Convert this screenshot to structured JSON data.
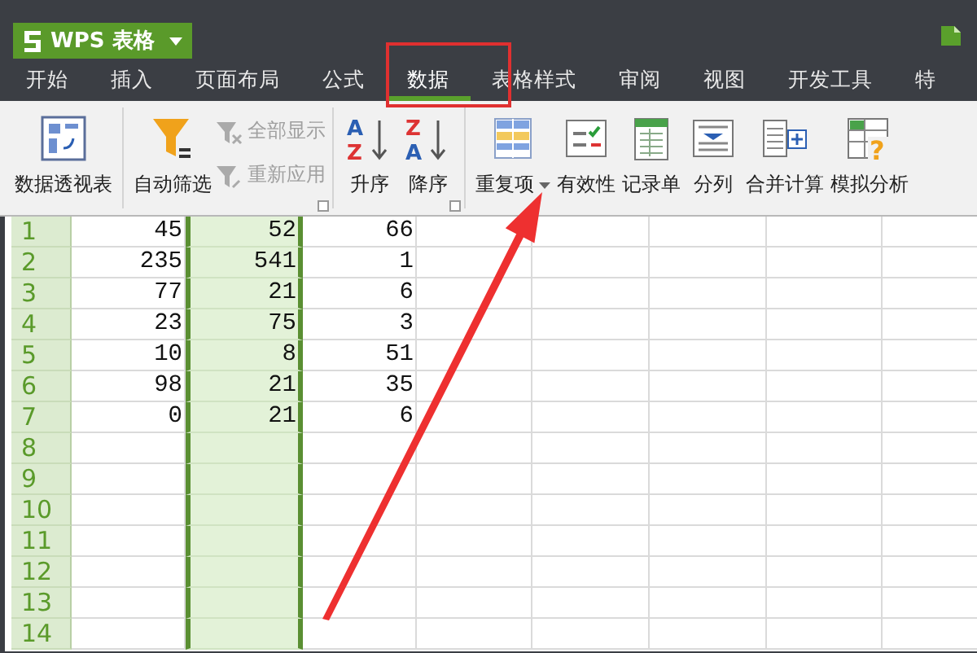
{
  "app": {
    "title": "WPS 表格"
  },
  "tabs": [
    {
      "label": "开始",
      "selected": false
    },
    {
      "label": "插入",
      "selected": false
    },
    {
      "label": "页面布局",
      "selected": false
    },
    {
      "label": "公式",
      "selected": false
    },
    {
      "label": "数据",
      "selected": true
    },
    {
      "label": "表格样式",
      "selected": false
    },
    {
      "label": "审阅",
      "selected": false
    },
    {
      "label": "视图",
      "selected": false
    },
    {
      "label": "开发工具",
      "selected": false
    },
    {
      "label": "特",
      "selected": false
    }
  ],
  "ribbon": [
    {
      "items": [
        {
          "kind": "large",
          "label": "数据透视表",
          "disabled": false,
          "dropdown": false
        }
      ],
      "launcher": false
    },
    {
      "items": [
        {
          "kind": "large",
          "label": "自动筛选",
          "disabled": false,
          "dropdown": false
        },
        {
          "kind": "small",
          "label": "全部显示",
          "disabled": true,
          "dropdown": false
        },
        {
          "kind": "small",
          "label": "重新应用",
          "disabled": true,
          "dropdown": false
        }
      ],
      "launcher": true
    },
    {
      "items": [
        {
          "kind": "large",
          "icon_text": [
            "A",
            "Z"
          ],
          "label": "升序",
          "disabled": false,
          "dropdown": false
        },
        {
          "kind": "large",
          "icon_text": [
            "Z",
            "A"
          ],
          "label": "降序",
          "disabled": false,
          "dropdown": false
        }
      ],
      "launcher": true
    },
    {
      "items": [
        {
          "kind": "large",
          "label": "重复项",
          "disabled": false,
          "dropdown": true
        },
        {
          "kind": "large",
          "label": "有效性",
          "disabled": false,
          "dropdown": false
        },
        {
          "kind": "large",
          "label": "记录单",
          "disabled": false,
          "dropdown": false
        },
        {
          "kind": "large",
          "label": "分列",
          "disabled": false,
          "dropdown": false
        },
        {
          "kind": "large",
          "label": "合并计算",
          "disabled": false,
          "dropdown": false
        },
        {
          "kind": "large",
          "icon_text": [
            "?"
          ],
          "label": "模拟分析",
          "disabled": false,
          "dropdown": false
        }
      ],
      "launcher": false
    }
  ],
  "sheet": {
    "columns": [
      {
        "selected": false
      },
      {
        "selected": true
      },
      {
        "selected": false
      },
      {
        "selected": false
      },
      {
        "selected": false
      },
      {
        "selected": false
      },
      {
        "selected": false
      },
      {
        "selected": false
      }
    ],
    "rows": [
      {
        "number": "1",
        "cells": [
          "45",
          "52",
          "66"
        ]
      },
      {
        "number": "2",
        "cells": [
          "235",
          "541",
          "1"
        ]
      },
      {
        "number": "3",
        "cells": [
          "77",
          "21",
          "6"
        ]
      },
      {
        "number": "4",
        "cells": [
          "23",
          "75",
          "3"
        ]
      },
      {
        "number": "5",
        "cells": [
          "10",
          "8",
          "51"
        ]
      },
      {
        "number": "6",
        "cells": [
          "98",
          "21",
          "35"
        ]
      },
      {
        "number": "7",
        "cells": [
          "0",
          "21",
          "6"
        ]
      },
      {
        "number": "8",
        "cells": []
      },
      {
        "number": "9",
        "cells": []
      },
      {
        "number": "10",
        "cells": []
      },
      {
        "number": "11",
        "cells": []
      },
      {
        "number": "12",
        "cells": []
      },
      {
        "number": "13",
        "cells": []
      },
      {
        "number": "14",
        "cells": []
      }
    ]
  },
  "annotations": [
    {
      "kind": "box"
    },
    {
      "kind": "arrow"
    }
  ]
}
